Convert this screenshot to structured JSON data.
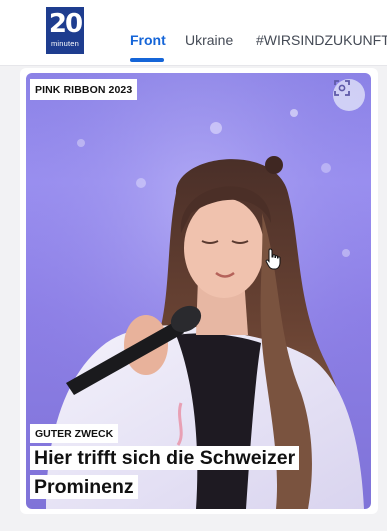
{
  "header": {
    "logo": {
      "number": "20",
      "word": "minuten"
    },
    "tabs": [
      {
        "label": "Front",
        "active": true
      },
      {
        "label": "Ukraine",
        "active": false
      },
      {
        "label": "#WIRSINDZUKUNFT",
        "active": false
      }
    ]
  },
  "article": {
    "badge": "PINK RIBBON 2023",
    "kicker": "GUTER ZWECK",
    "headline": "Hier trifft sich die Schweizer Prominenz",
    "focus_icon": "focus-scan-icon"
  },
  "colors": {
    "accent": "#1565d8",
    "logo_bg": "#1e3d8f",
    "hero_bg": "#8b82e6"
  }
}
